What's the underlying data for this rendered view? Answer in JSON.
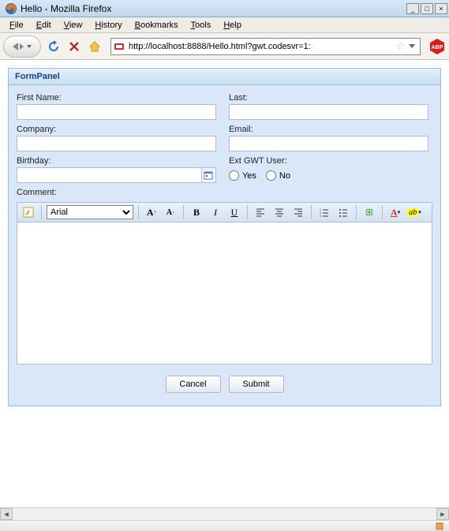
{
  "window": {
    "title": "Hello - Mozilla Firefox",
    "min": "_",
    "max": "□",
    "close": "×"
  },
  "menus": {
    "file": "File",
    "edit": "Edit",
    "view": "View",
    "history": "History",
    "bookmarks": "Bookmarks",
    "tools": "Tools",
    "help": "Help"
  },
  "url": "http://localhost:8888/Hello.html?gwt.codesvr=1:",
  "panel": {
    "title": "FormPanel"
  },
  "form": {
    "firstName": {
      "label": "First Name:",
      "value": ""
    },
    "last": {
      "label": "Last:",
      "value": ""
    },
    "company": {
      "label": "Company:",
      "value": ""
    },
    "email": {
      "label": "Email:",
      "value": ""
    },
    "birthday": {
      "label": "Birthday:",
      "value": ""
    },
    "gwtUser": {
      "label": "Ext GWT User:",
      "yes": "Yes",
      "no": "No"
    },
    "comment": {
      "label": "Comment:"
    }
  },
  "editor": {
    "font": "Arial",
    "fonts": [
      "Arial"
    ]
  },
  "buttons": {
    "cancel": "Cancel",
    "submit": "Submit"
  },
  "icons": {
    "reload": "reload-icon",
    "stop": "stop-icon",
    "home": "home-icon",
    "abp": "abp-icon"
  }
}
